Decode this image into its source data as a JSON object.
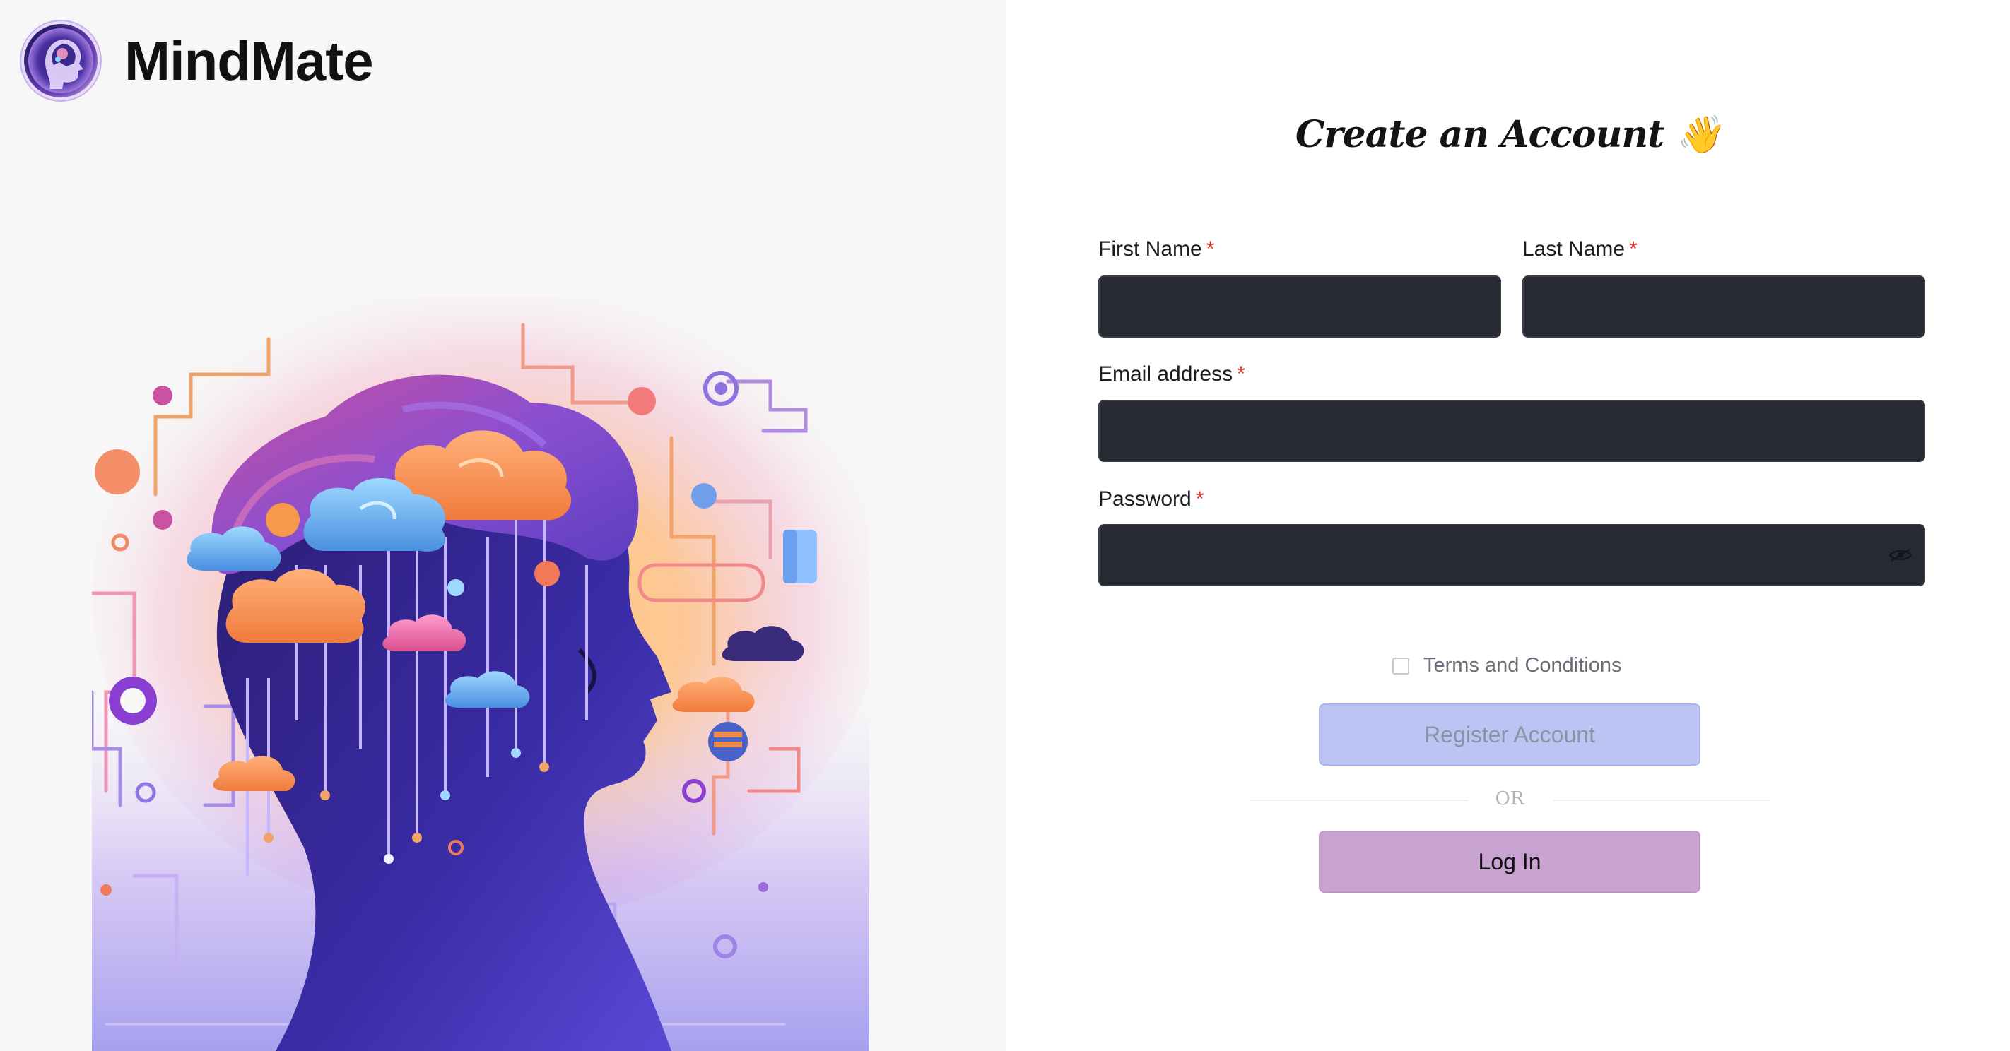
{
  "brand": {
    "name": "MindMate"
  },
  "form": {
    "title": "Create an Account 👋",
    "first_name": {
      "label": "First Name",
      "required_mark": "*",
      "value": ""
    },
    "last_name": {
      "label": "Last Name",
      "required_mark": "*",
      "value": ""
    },
    "email": {
      "label": "Email address",
      "required_mark": "*",
      "value": ""
    },
    "password": {
      "label": "Password",
      "required_mark": "*",
      "value": ""
    },
    "terms_label": "Terms and Conditions",
    "terms_checked": false,
    "register_label": "Register Account",
    "divider_text": "OR",
    "login_label": "Log In"
  },
  "icons": {
    "logo": "brain-head-logo-icon",
    "password_toggle": "eye-off-icon"
  },
  "colors": {
    "input_bg": "#282a33",
    "register_bg": "#bcc4f4",
    "login_bg": "#caa4d1",
    "required": "#d93025"
  }
}
